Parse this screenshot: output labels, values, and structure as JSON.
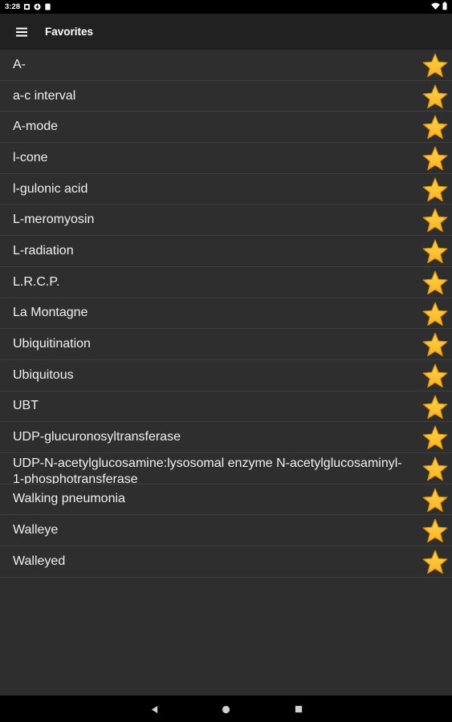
{
  "status_bar": {
    "time": "3:28",
    "left_icons": [
      "sim-icon",
      "download-icon",
      "app-icon"
    ],
    "right_icons": [
      "wifi-icon",
      "battery-icon"
    ]
  },
  "app_bar": {
    "menu_icon": "hamburger-menu-icon",
    "title": "Favorites"
  },
  "favorites": [
    {
      "label": "A-"
    },
    {
      "label": "a-c interval"
    },
    {
      "label": "A-mode"
    },
    {
      "label": "l-cone"
    },
    {
      "label": "l-gulonic acid"
    },
    {
      "label": "L-meromyosin"
    },
    {
      "label": "L-radiation"
    },
    {
      "label": "L.R.C.P."
    },
    {
      "label": "La Montagne"
    },
    {
      "label": "Ubiquitination"
    },
    {
      "label": "Ubiquitous"
    },
    {
      "label": "UBT"
    },
    {
      "label": "UDP-glucuronosyltransferase"
    },
    {
      "label": "UDP-N-acetylglucosamine:lysosomal enzyme N-acetylglucosaminyl-1-phosphotransferase"
    },
    {
      "label": "Walking pneumonia"
    },
    {
      "label": "Walleye"
    },
    {
      "label": "Walleyed"
    }
  ],
  "colors": {
    "star_fill": "#f9b323",
    "star_edge": "#e08a00",
    "background": "#2e2e2e",
    "app_bar": "#212121"
  },
  "nav_bar": {
    "buttons": [
      "back-icon",
      "home-icon",
      "recents-icon"
    ]
  }
}
